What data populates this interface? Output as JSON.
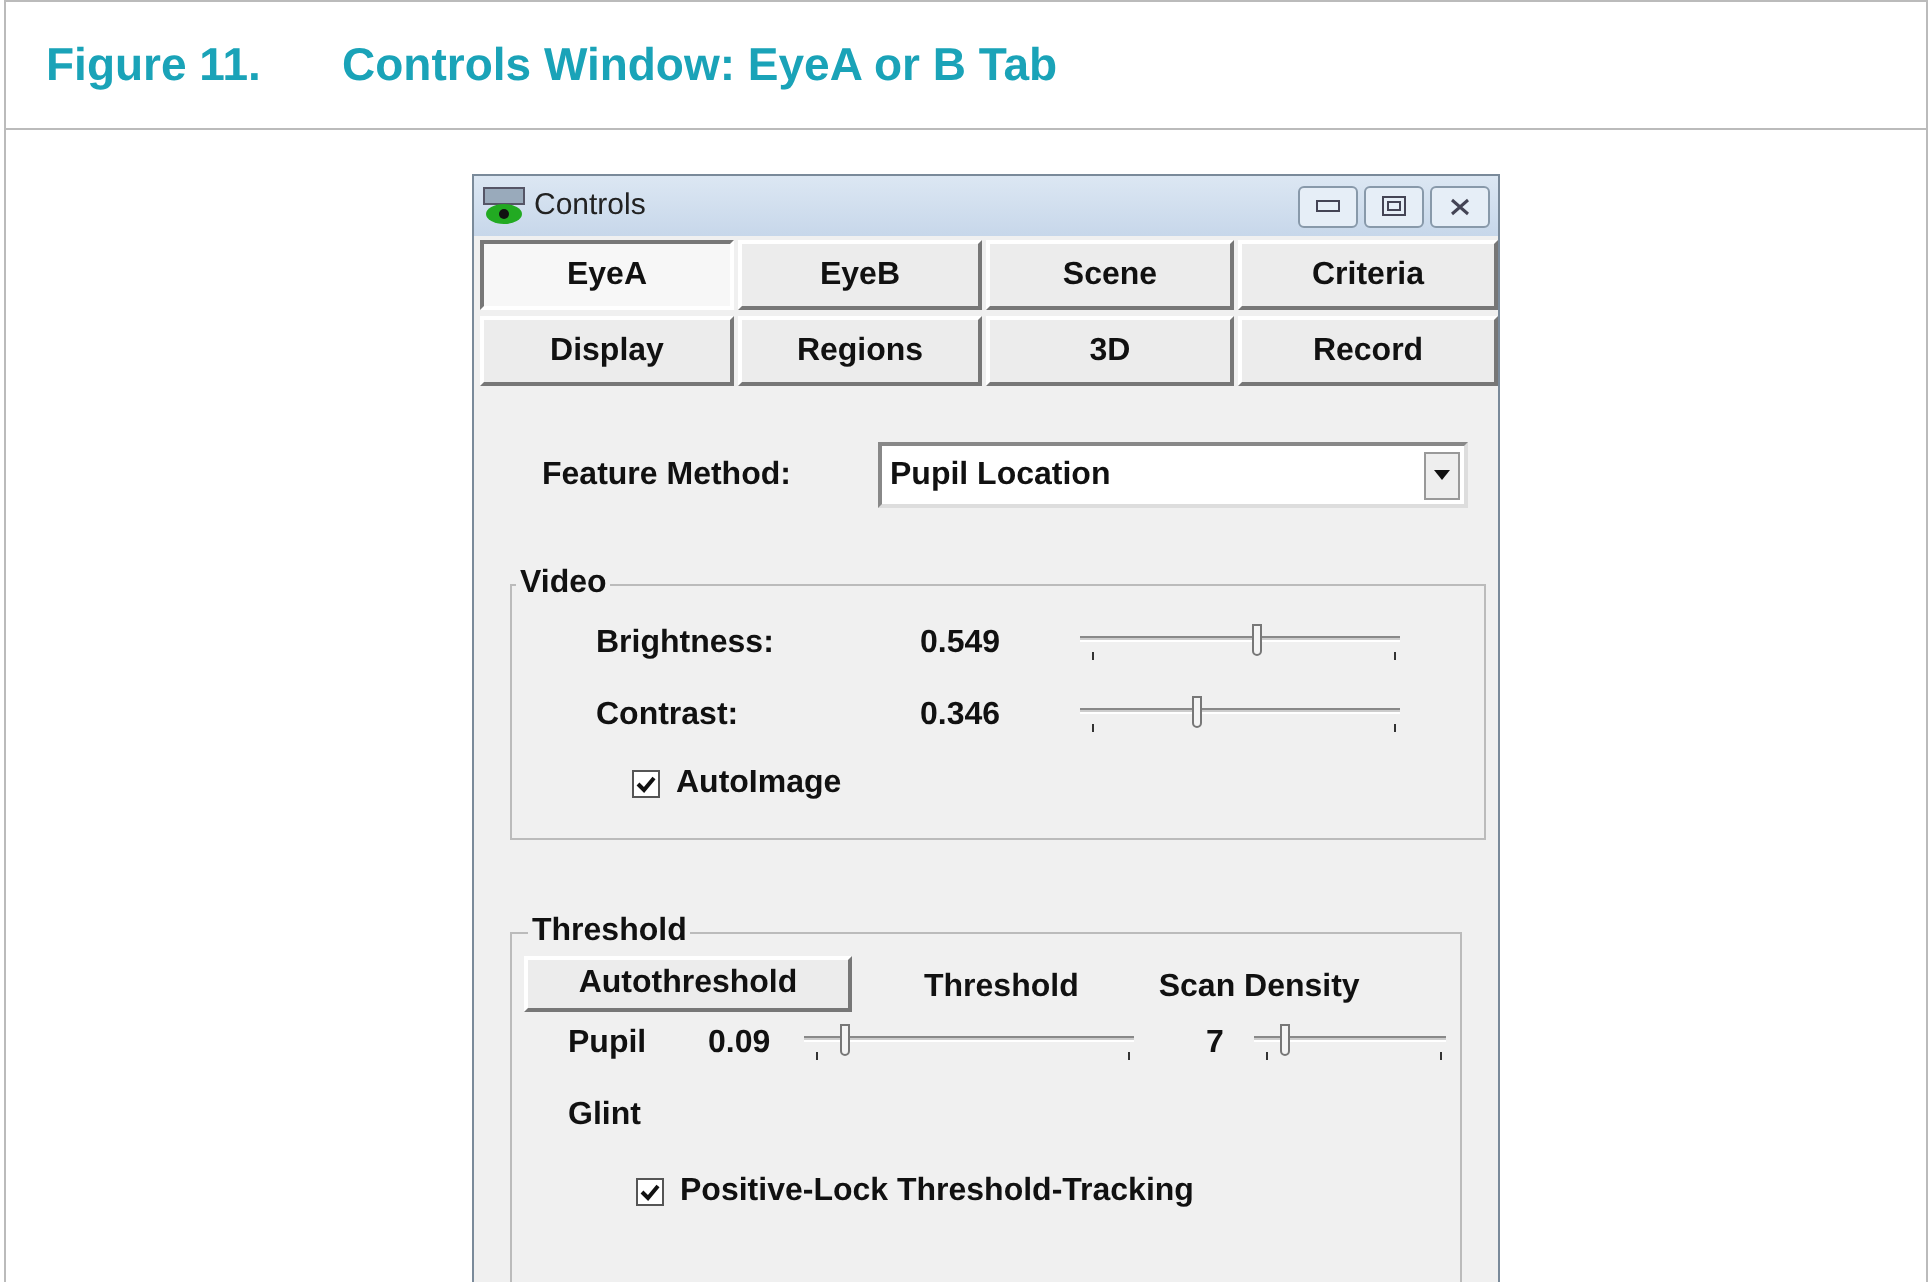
{
  "figure": {
    "number": "Figure 11.",
    "caption": "Controls Window: EyeA or B Tab"
  },
  "window": {
    "title": "Controls"
  },
  "tabs": [
    {
      "label": "EyeA",
      "selected": true
    },
    {
      "label": "EyeB",
      "selected": false
    },
    {
      "label": "Scene",
      "selected": false
    },
    {
      "label": "Criteria",
      "selected": false
    },
    {
      "label": "Display",
      "selected": false
    },
    {
      "label": "Regions",
      "selected": false
    },
    {
      "label": "3D",
      "selected": false
    },
    {
      "label": "Record",
      "selected": false
    }
  ],
  "feature_method": {
    "label": "Feature Method:",
    "value": "Pupil Location"
  },
  "video": {
    "title": "Video",
    "sliders": [
      {
        "label": "Brightness:",
        "reading": "0.549",
        "level": 0.55
      },
      {
        "label": "Contrast:",
        "reading": "0.346",
        "level": 0.36
      }
    ],
    "autoimage": {
      "label": "AutoImage",
      "checked": true
    }
  },
  "threshold": {
    "title": "Threshold",
    "button": "Autothreshold",
    "threshold_heading": "Threshold",
    "scan_heading": "Scan Density",
    "pupil": {
      "label": "Pupil",
      "reading": "0.09",
      "level": 0.12
    },
    "scan_density": {
      "reading": "7",
      "level": 0.16
    },
    "glint_label": "Glint",
    "tracking": {
      "label": "Positive-Lock Threshold-Tracking",
      "checked": true
    }
  }
}
